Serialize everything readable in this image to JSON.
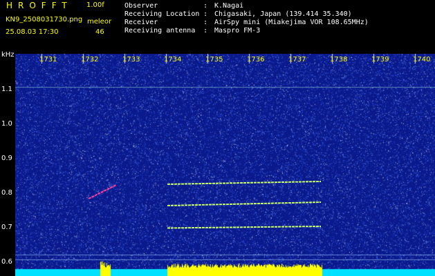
{
  "header": {
    "app_name": "HROFFT",
    "version": "1.00f",
    "filename": "KN9_2508031730.png",
    "algorithm_label": "meleor",
    "datetime": "25.08.03 17:30",
    "count": "46"
  },
  "meta": [
    {
      "key": "Observer",
      "value": "K.Nagai"
    },
    {
      "key": "Receiving Location",
      "value": "Chigasaki, Japan (139.414 35.340)"
    },
    {
      "key": "Receiver",
      "value": "AirSpy mini (Miakejima VOR 108.65MHz)"
    },
    {
      "key": "Receiving antenna",
      "value": "Maspro FM-3"
    }
  ],
  "chart_data": {
    "type": "heatmap",
    "title": "",
    "ylabel": "kHz",
    "x_ticks": [
      "1731",
      "1732",
      "1733",
      "1734",
      "1735",
      "1736",
      "1737",
      "1738",
      "1739",
      "1740"
    ],
    "y_ticks": [
      "1.1",
      "1.0",
      "0.9",
      "0.8",
      "0.7",
      "0.6"
    ],
    "ylim": [
      0.58,
      1.18
    ],
    "colors": {
      "background": "#0a1a8c",
      "noise": "#3c64ff",
      "trace": "#c8ff64",
      "meteor": "#ff40a0",
      "bar": "#ffff00",
      "bar_base": "#00e0ff"
    },
    "traces": [
      {
        "x1": "1734",
        "x2": "1738",
        "y1": 0.822,
        "y2": 0.83
      },
      {
        "x1": "1734",
        "x2": "1738",
        "y1": 0.76,
        "y2": 0.77
      },
      {
        "x1": "1734",
        "x2": "1738",
        "y1": 0.695,
        "y2": 0.7
      },
      {
        "x1": "1732",
        "x2": "1733",
        "y1": 0.78,
        "y2": 0.82
      }
    ]
  }
}
